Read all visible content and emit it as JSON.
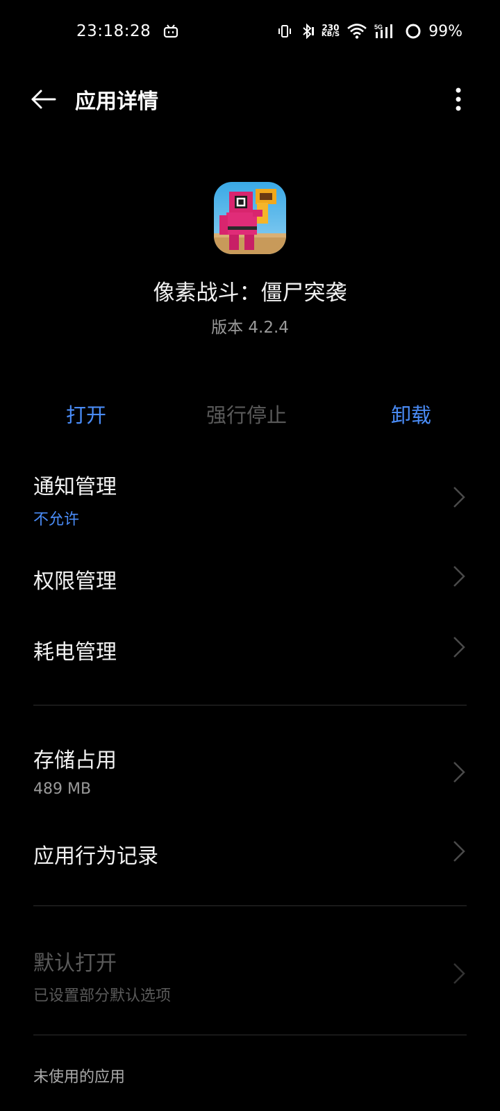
{
  "status_bar": {
    "time": "23:18:28",
    "net_speed_value": "230",
    "net_speed_unit": "KB/S",
    "network_type": "5G",
    "battery": "99%"
  },
  "header": {
    "title": "应用详情"
  },
  "app": {
    "name": "像素战斗：僵尸突袭",
    "version": "版本 4.2.4"
  },
  "actions": {
    "open": "打开",
    "force_stop": "强行停止",
    "uninstall": "卸载"
  },
  "items": {
    "notification": {
      "title": "通知管理",
      "sub": "不允许"
    },
    "permissions": {
      "title": "权限管理"
    },
    "battery": {
      "title": "耗电管理"
    },
    "storage": {
      "title": "存储占用",
      "sub": "489 MB"
    },
    "behavior": {
      "title": "应用行为记录"
    },
    "default_open": {
      "title": "默认打开",
      "sub": "已设置部分默认选项"
    }
  },
  "section": {
    "unused_apps": "未使用的应用"
  },
  "colors": {
    "accent": "#4a8cf7",
    "disabled": "#5a5a5a",
    "background": "#000000"
  }
}
